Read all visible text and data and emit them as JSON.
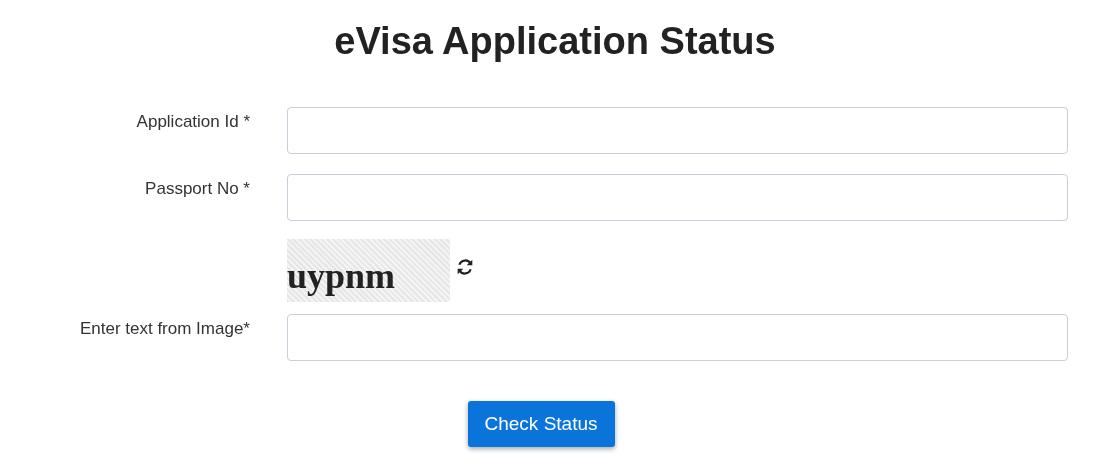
{
  "title": "eVisa Application Status",
  "fields": [
    {
      "kind": "input",
      "label": "Application Id *"
    },
    {
      "kind": "input",
      "label": "Passport No *"
    },
    {
      "kind": "captcha",
      "text": "uypnm"
    },
    {
      "kind": "input",
      "label": "Enter text from Image*"
    }
  ],
  "button": "Check Status"
}
